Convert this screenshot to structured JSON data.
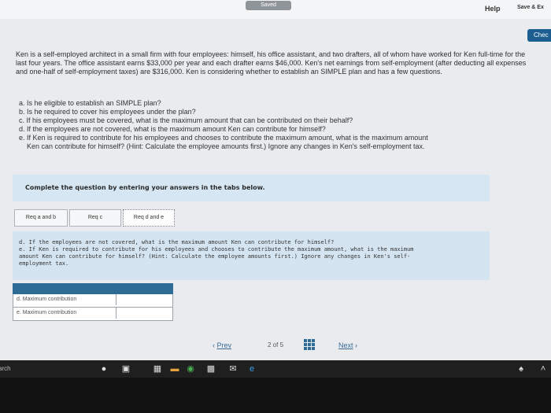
{
  "header": {
    "saved_label": "Saved",
    "help_label": "Help",
    "save_exit_label": "Save & Ex"
  },
  "check_label": "Chec",
  "problem": {
    "text": "Ken is a self-employed architect in a small firm with four employees: himself, his office assistant, and two drafters, all of whom have worked for Ken full-time for the last four years. The office assistant earns $33,000 per year and each drafter earns $46,000. Ken's net earnings from self-employment (after deducting all expenses and one-half of self-employment taxes) are $316,000. Ken is considering whether to establish an SIMPLE plan and has a few questions."
  },
  "questions": [
    "a. Is he eligible to establish an SIMPLE plan?",
    "b. Is he required to cover his employees under the plan?",
    "c. If his employees must be covered, what is the maximum amount that can be contributed on their behalf?",
    "d. If the employees are not covered, what is the maximum amount Ken can contribute for himself?",
    "e. If Ken is required to contribute for his employees and chooses to contribute the maximum amount, what is the maximum amount",
    "Ken can contribute for himself? (Hint: Calculate the employee amounts first.) Ignore any changes in Ken's self-employment tax."
  ],
  "instruction": "Complete the question by entering your answers in the tabs below.",
  "tabs": [
    "Req a and b",
    "Req c",
    "Req d and e"
  ],
  "active_tab": "Req d and e",
  "question_box": {
    "line1": "d. If the employees are not covered, what is the maximum amount Ken can contribute for himself?",
    "line2": "e. If Ken is required to contribute for his employees and chooses to contribute the maximum amount, what is the maximum",
    "line3": "amount Ken can contribute for himself? (Hint: Calculate the employee amounts first.) Ignore any changes in Ken's self-",
    "line4": "employment tax."
  },
  "answers": [
    {
      "label": "d. Maximum contribution",
      "value": ""
    },
    {
      "label": "e. Maximum contribution",
      "value": ""
    }
  ],
  "pager": {
    "prev_label": "Prev",
    "page_text": "2 of 5",
    "next_label": "Next"
  },
  "taskbar": {
    "search_label": "arch"
  }
}
